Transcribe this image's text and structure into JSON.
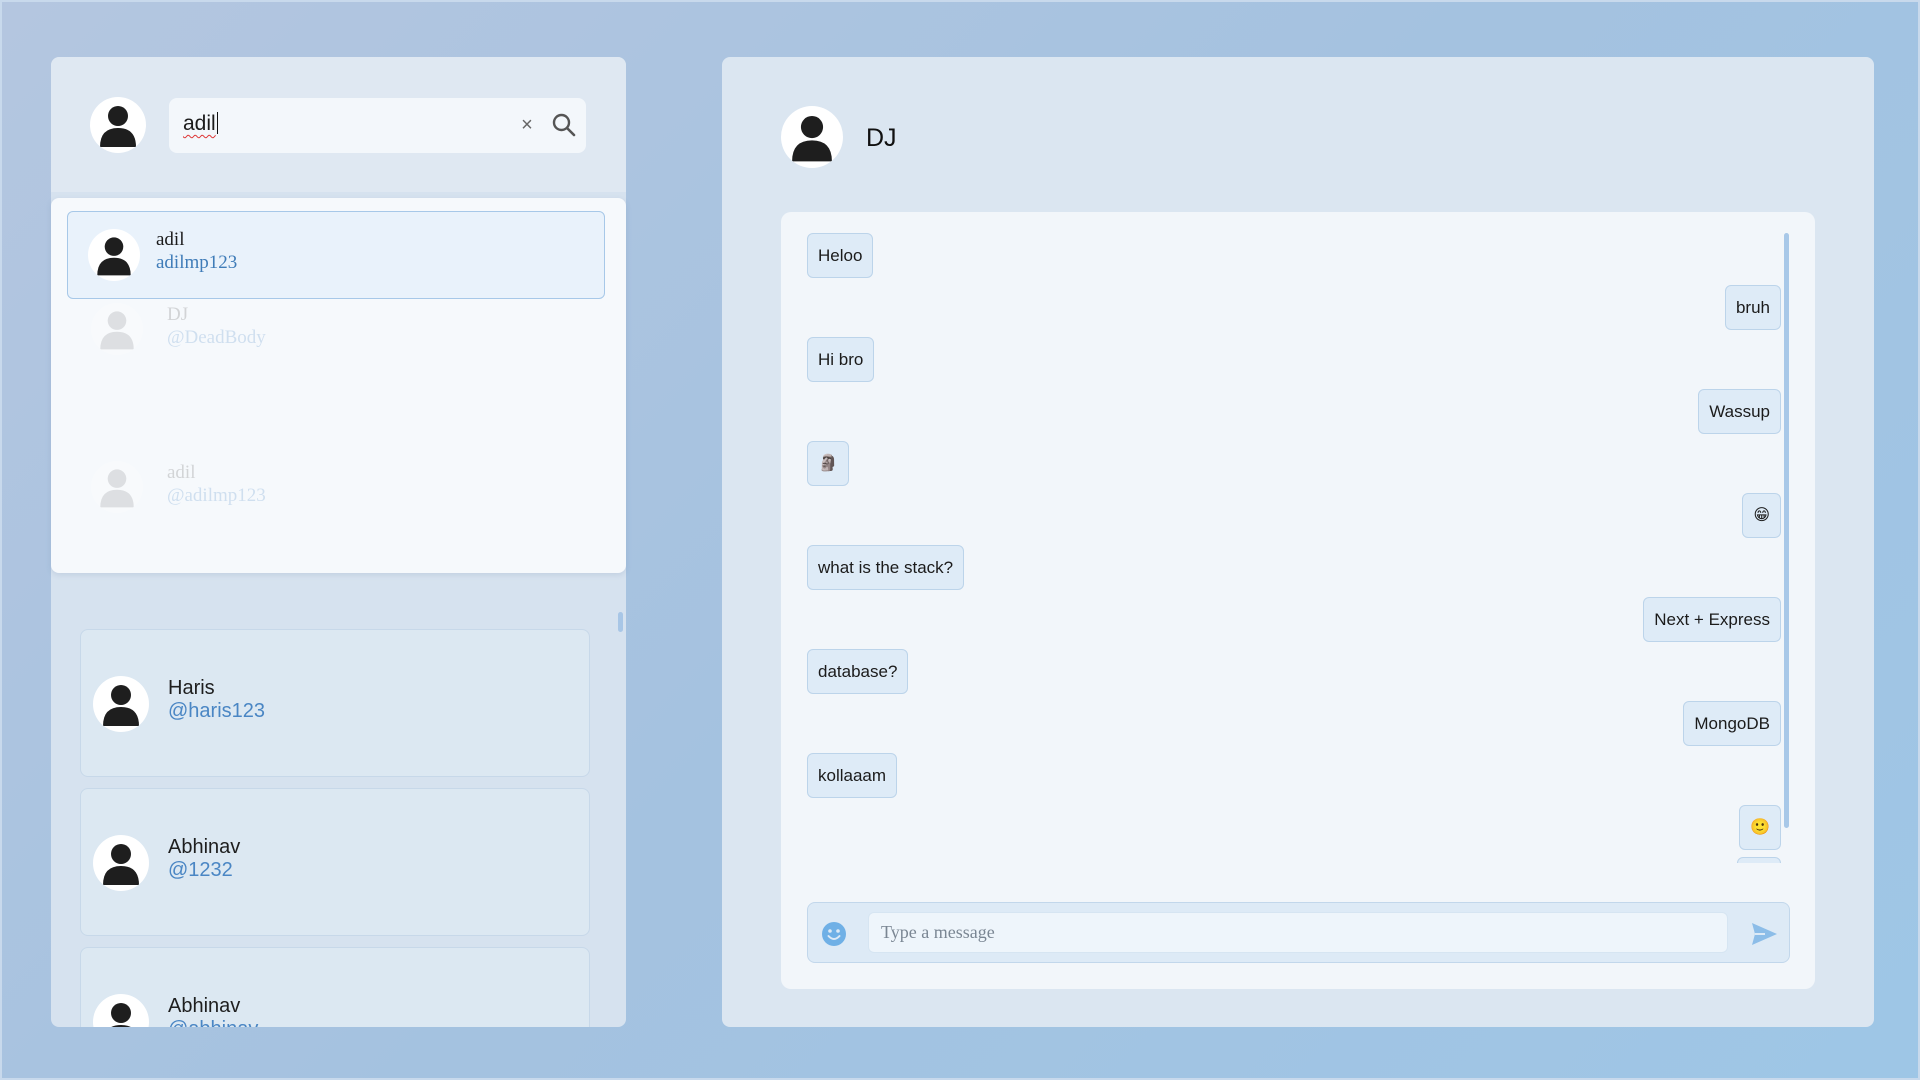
{
  "sidebar": {
    "search": {
      "value": "adil",
      "clear_label": "×"
    },
    "dropdown": {
      "results": [
        {
          "name": "adil",
          "username": "adilmp123"
        }
      ],
      "ghost_items": [
        {
          "name": "DJ",
          "username": "@DeadBody"
        },
        {
          "name": "adil",
          "username": "@adilmp123"
        }
      ]
    },
    "contacts": [
      {
        "name": "Haris",
        "username": "@haris123"
      },
      {
        "name": "Abhinav",
        "username": "@1232"
      },
      {
        "name": "Abhinav",
        "username": "@abhinav"
      }
    ]
  },
  "chat": {
    "contact_name": "DJ",
    "messages": [
      {
        "text": "Heloo",
        "side": "left"
      },
      {
        "text": "bruh",
        "side": "right"
      },
      {
        "text": "Hi bro",
        "side": "left"
      },
      {
        "text": "Wassup",
        "side": "right"
      },
      {
        "text": "🗿",
        "side": "left"
      },
      {
        "text": "😁",
        "side": "right"
      },
      {
        "text": "what is the stack?",
        "side": "left"
      },
      {
        "text": "Next + Express",
        "side": "right"
      },
      {
        "text": "database?",
        "side": "left"
      },
      {
        "text": "MongoDB",
        "side": "right"
      },
      {
        "text": "kollaaam",
        "side": "left"
      },
      {
        "text": "🙂",
        "side": "right"
      }
    ],
    "composer": {
      "placeholder": "Type a message"
    }
  },
  "colors": {
    "accent": "#4a86c4",
    "panel": "#dbe6f1",
    "bubble": "#deebf7"
  }
}
